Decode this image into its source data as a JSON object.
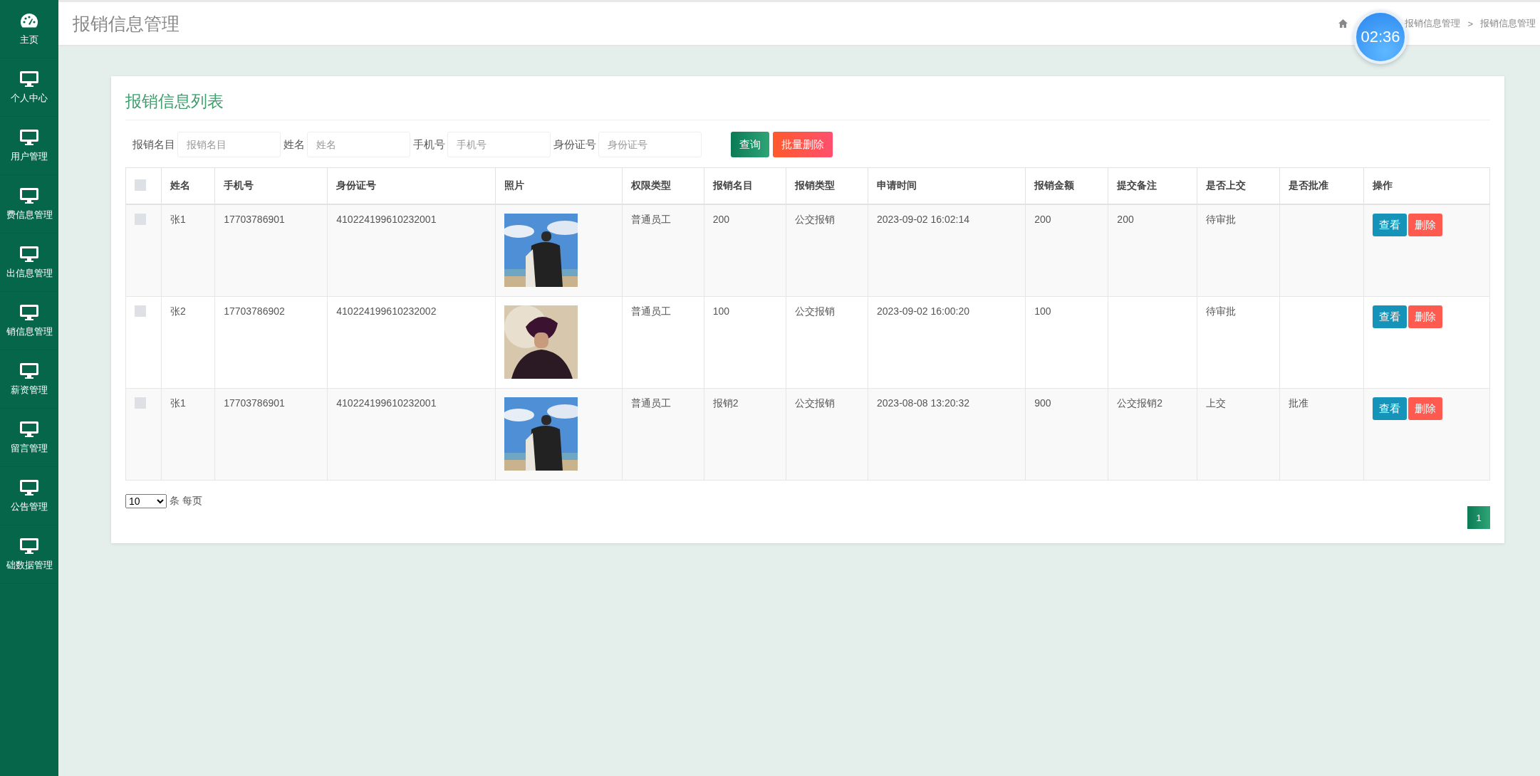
{
  "sidebar": {
    "items": [
      {
        "label": "主页",
        "kind": "dashboard"
      },
      {
        "label": "个人中心",
        "kind": "monitor"
      },
      {
        "label": "用户管理",
        "kind": "monitor"
      },
      {
        "label": "费信息管理",
        "kind": "monitor"
      },
      {
        "label": "出信息管理",
        "kind": "monitor"
      },
      {
        "label": "销信息管理",
        "kind": "monitor"
      },
      {
        "label": "薪资管理",
        "kind": "monitor"
      },
      {
        "label": "留言管理",
        "kind": "monitor"
      },
      {
        "label": "公告管理",
        "kind": "monitor"
      },
      {
        "label": "础数据管理",
        "kind": "monitor"
      }
    ]
  },
  "header": {
    "title": "报销信息管理",
    "breadcrumb": [
      "报销信息管理",
      "报销信息管理"
    ],
    "separator": ">"
  },
  "timer": "02:36",
  "card": {
    "title": "报销信息列表",
    "search_fields": [
      {
        "label": "报销名目",
        "placeholder": "报销名目"
      },
      {
        "label": "姓名",
        "placeholder": "姓名"
      },
      {
        "label": "手机号",
        "placeholder": "手机号"
      },
      {
        "label": "身份证号",
        "placeholder": "身份证号"
      }
    ],
    "buttons": [
      {
        "label": "查询",
        "kind": "primary"
      },
      {
        "label": "批量删除",
        "kind": "danger"
      }
    ]
  },
  "table": {
    "header_checked": false,
    "columns": [
      "姓名",
      "手机号",
      "身份证号",
      "照片",
      "权限类型",
      "报销名目",
      "报销类型",
      "申请时间",
      "报销金额",
      "提交备注",
      "是否上交",
      "是否批准",
      "操作"
    ],
    "rows": [
      {
        "checked": false,
        "cells": [
          "张1",
          "17703786901",
          "410224199610232001"
        ],
        "photo": {
          "kind": "picture"
        },
        "fields": {
          "permission_type": "普通员工",
          "item": "200",
          "claim_type": "公交报销",
          "applied_at": "2023-09-02 16:02:14",
          "amount": "200",
          "note": "200",
          "submitted": "待审批"
        },
        "actions": [
          "查看",
          "删除"
        ]
      },
      {
        "checked": false,
        "cells": [
          "张2",
          "17703786902",
          "410224199610232002"
        ],
        "photo": {
          "kind": "picture"
        },
        "fields": {
          "permission_type": "普通员工",
          "item": "100",
          "claim_type": "公交报销",
          "applied_at": "2023-09-02 16:00:20",
          "amount": "100",
          "submitted": "待审批"
        },
        "actions": [
          "查看",
          "删除"
        ]
      },
      {
        "checked": false,
        "cells": [
          "张1",
          "17703786901",
          "410224199610232001"
        ],
        "photo": {
          "kind": "picture"
        },
        "fields": {
          "permission_type": "普通员工",
          "item": "报销2",
          "claim_type": "公交报销",
          "applied_at": "2023-08-08 13:20:32",
          "amount": "900",
          "note": "公交报销2",
          "submitted": "上交",
          "approved": "批准"
        },
        "actions": [
          "查看",
          "删除"
        ]
      }
    ]
  },
  "pagination": {
    "page_size": "10",
    "page_size_label": "条 每页",
    "pages": [
      {
        "label": "1",
        "selected": true
      }
    ]
  }
}
